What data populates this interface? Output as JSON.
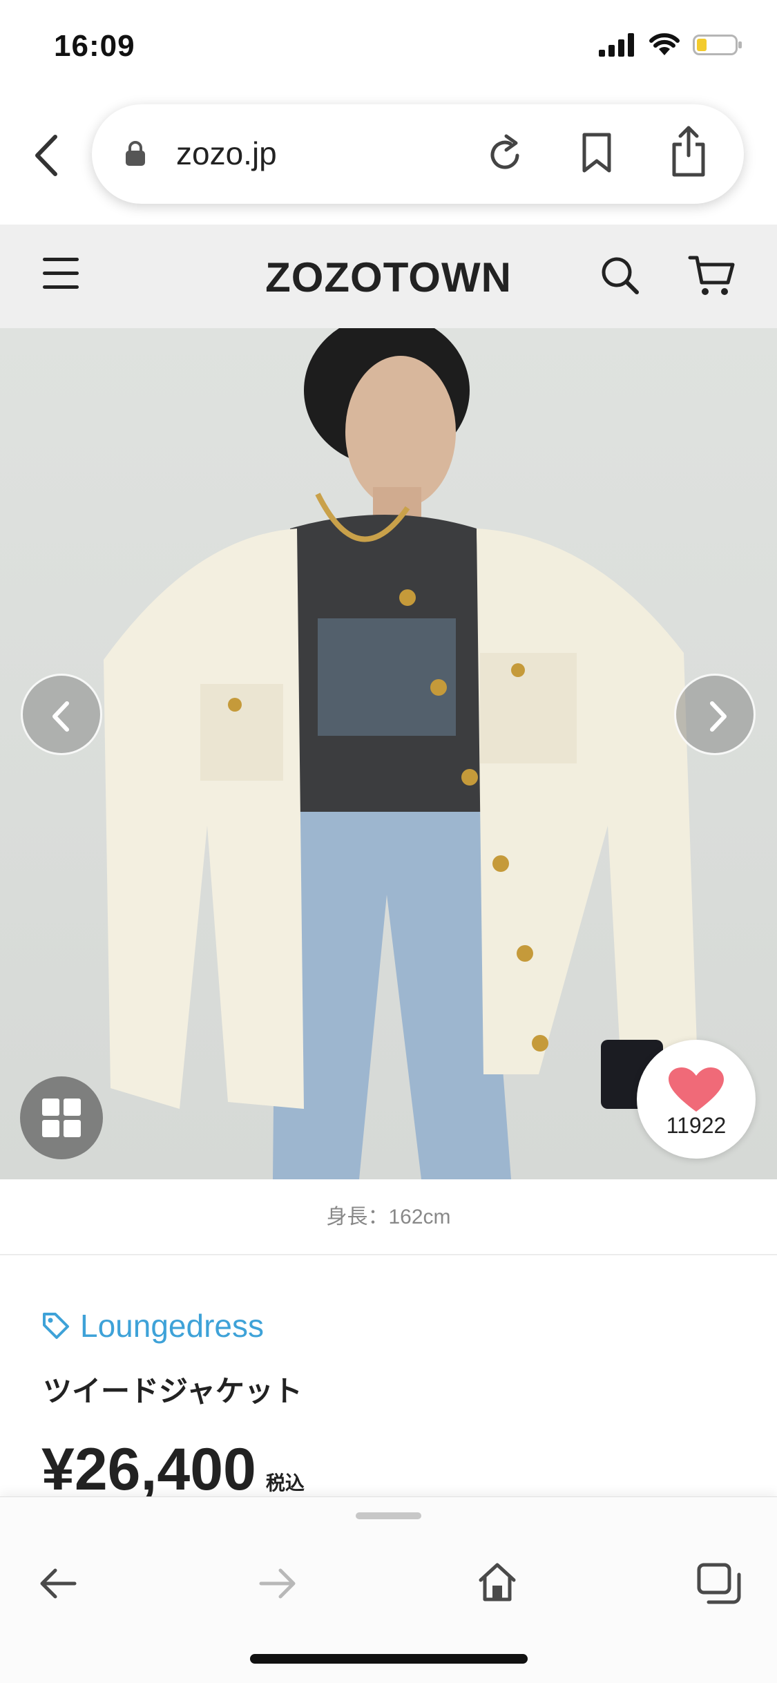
{
  "status_bar": {
    "time": "16:09",
    "icons": [
      "cellular-signal-icon",
      "wifi-icon",
      "battery-low-icon"
    ]
  },
  "browser": {
    "url": "zozo.jp",
    "icons": [
      "back-chevron-icon",
      "lock-icon",
      "reload-icon",
      "bookmark-icon",
      "share-icon"
    ]
  },
  "site_header": {
    "logo": "ZOZOTOWN",
    "icons": [
      "hamburger-menu-icon",
      "search-icon",
      "cart-icon"
    ]
  },
  "product": {
    "image_description_icon": "photo",
    "favorite_count": "11922",
    "height_caption": "身長：162cm",
    "brand": "Loungedress",
    "title": "ツイードジャケット",
    "price": "¥26,400",
    "tax_label": "税込"
  },
  "toolbar": {
    "icons": [
      "back-arrow-icon",
      "forward-arrow-icon",
      "home-icon",
      "tabs-icon"
    ]
  },
  "colors": {
    "brand_link": "#3ea2d8",
    "heart": "#f06a78",
    "header_bg": "#efefef"
  }
}
